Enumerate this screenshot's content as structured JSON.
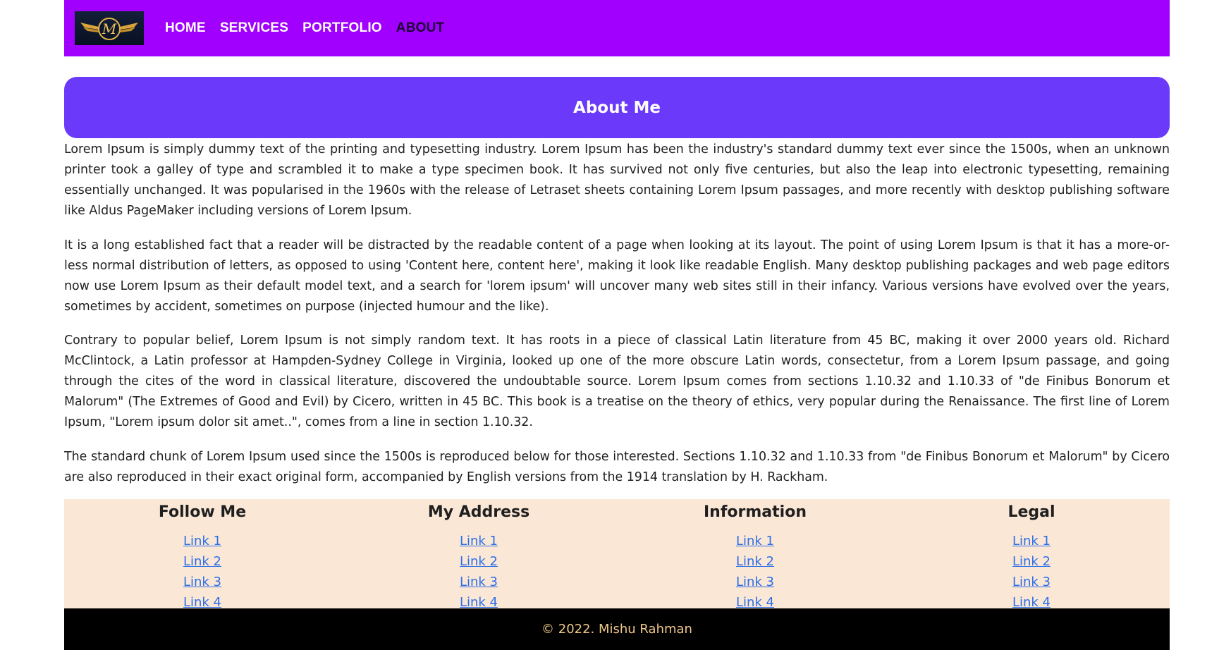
{
  "nav": {
    "logo_letter": "M",
    "items": [
      {
        "label": "HOME"
      },
      {
        "label": "SERVICES"
      },
      {
        "label": "PORTFOLIO"
      },
      {
        "label": "ABOUT"
      }
    ]
  },
  "about": {
    "title": "About Me",
    "paragraphs": [
      "Lorem Ipsum is simply dummy text of the printing and typesetting industry. Lorem Ipsum has been the industry's standard dummy text ever since the 1500s, when an unknown printer took a galley of type and scrambled it to make a type specimen book. It has survived not only five centuries, but also the leap into electronic typesetting, remaining essentially unchanged. It was popularised in the 1960s with the release of Letraset sheets containing Lorem Ipsum passages, and more recently with desktop publishing software like Aldus PageMaker including versions of Lorem Ipsum.",
      "It is a long established fact that a reader will be distracted by the readable content of a page when looking at its layout. The point of using Lorem Ipsum is that it has a more-or-less normal distribution of letters, as opposed to using 'Content here, content here', making it look like readable English. Many desktop publishing packages and web page editors now use Lorem Ipsum as their default model text, and a search for 'lorem ipsum' will uncover many web sites still in their infancy. Various versions have evolved over the years, sometimes by accident, sometimes on purpose (injected humour and the like).",
      "Contrary to popular belief, Lorem Ipsum is not simply random text. It has roots in a piece of classical Latin literature from 45 BC, making it over 2000 years old. Richard McClintock, a Latin professor at Hampden-Sydney College in Virginia, looked up one of the more obscure Latin words, consectetur, from a Lorem Ipsum passage, and going through the cites of the word in classical literature, discovered the undoubtable source. Lorem Ipsum comes from sections 1.10.32 and 1.10.33 of \"de Finibus Bonorum et Malorum\" (The Extremes of Good and Evil) by Cicero, written in 45 BC. This book is a treatise on the theory of ethics, very popular during the Renaissance. The first line of Lorem Ipsum, \"Lorem ipsum dolor sit amet..\", comes from a line in section 1.10.32.",
      "The standard chunk of Lorem Ipsum used since the 1500s is reproduced below for those interested. Sections 1.10.32 and 1.10.33 from \"de Finibus Bonorum et Malorum\" by Cicero are also reproduced in their exact original form, accompanied by English versions from the 1914 translation by H. Rackham."
    ]
  },
  "footer": {
    "columns": [
      {
        "heading": "Follow Me",
        "links": [
          "Link 1",
          "Link 2",
          "Link 3",
          "Link 4"
        ]
      },
      {
        "heading": "My Address",
        "links": [
          "Link 1",
          "Link 2",
          "Link 3",
          "Link 4"
        ]
      },
      {
        "heading": "Information",
        "links": [
          "Link 1",
          "Link 2",
          "Link 3",
          "Link 4"
        ]
      },
      {
        "heading": "Legal",
        "links": [
          "Link 1",
          "Link 2",
          "Link 3",
          "Link 4"
        ]
      }
    ],
    "copyright": "© 2022. Mishu Rahman"
  },
  "colors": {
    "nav_bg": "#a100ff",
    "about_bg": "#6a39fa",
    "footer_bg": "#fbe7d6",
    "bottom_bg": "#000000",
    "link": "#2b6fe8",
    "copyright": "#f0c78a"
  }
}
